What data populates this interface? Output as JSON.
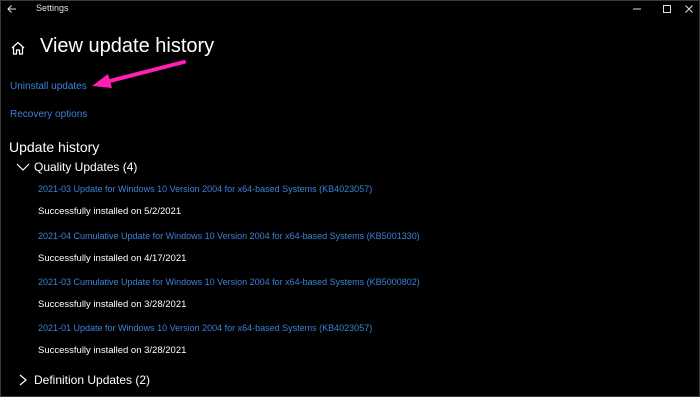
{
  "titlebar": {
    "app_title": "Settings"
  },
  "page": {
    "title": "View update history"
  },
  "links": {
    "uninstall": "Uninstall updates",
    "recovery": "Recovery options"
  },
  "history": {
    "title": "Update history",
    "quality_group": {
      "label": "Quality Updates (4)",
      "expanded": true,
      "items": [
        {
          "name": "2021-03 Update for Windows 10 Version 2004 for x64-based Systems (KB4023057)",
          "status": "Successfully installed on 5/2/2021"
        },
        {
          "name": "2021-04 Cumulative Update for Windows 10 Version 2004 for x64-based Systems (KB5001330)",
          "status": "Successfully installed on 4/17/2021"
        },
        {
          "name": "2021-03 Cumulative Update for Windows 10 Version 2004 for x64-based Systems (KB5000802)",
          "status": "Successfully installed on 3/28/2021"
        },
        {
          "name": "2021-01 Update for Windows 10 Version 2004 for x64-based Systems (KB4023057)",
          "status": "Successfully installed on 3/28/2021"
        }
      ]
    },
    "definition_group": {
      "label": "Definition Updates (2)",
      "expanded": false
    }
  },
  "icons": {
    "back": "back-arrow-icon",
    "home": "home-icon",
    "minimize": "minimize-icon",
    "maximize": "maximize-icon",
    "close": "close-icon",
    "expanded": "chevron-down-icon",
    "collapsed": "chevron-right-icon"
  },
  "colors": {
    "background": "#000000",
    "link": "#3b82d6",
    "text": "#ffffff",
    "annotation_arrow": "#ff1fb4"
  }
}
